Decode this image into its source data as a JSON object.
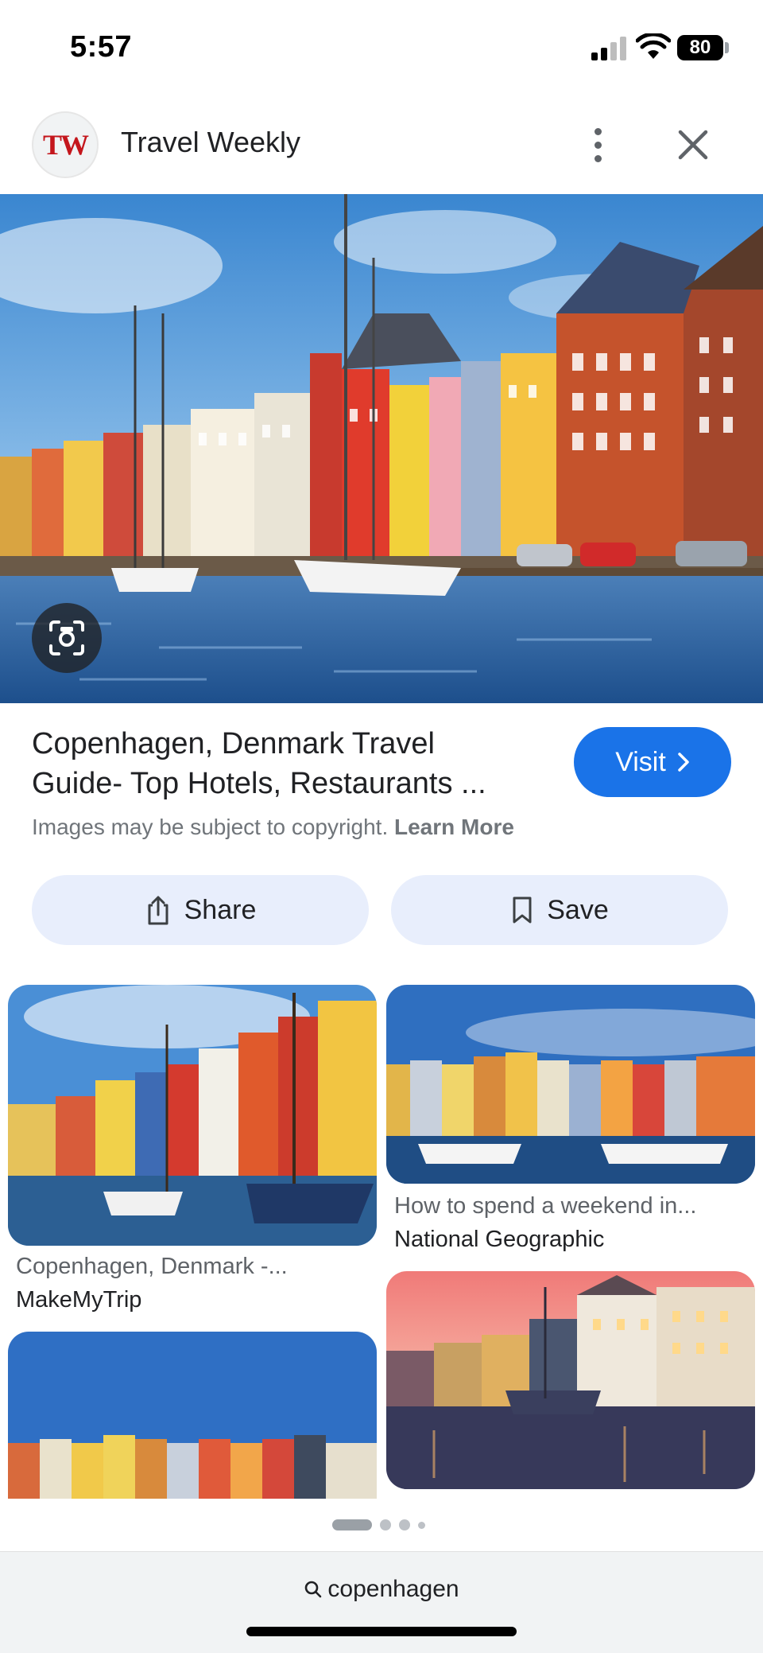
{
  "status": {
    "time": "5:57",
    "battery": "80"
  },
  "header": {
    "logo_text": "TW",
    "site_name": "Travel Weekly"
  },
  "result": {
    "title_line1": "Copenhagen, Denmark Travel",
    "title_line2": "Guide- Top Hotels, Restaurants ...",
    "visit_label": "Visit",
    "copyright_text": "Images may be subject to copyright.",
    "learn_more": "Learn More",
    "share_label": "Share",
    "save_label": "Save"
  },
  "related": [
    {
      "title": "Copenhagen, Denmark -...",
      "source": "MakeMyTrip"
    },
    {
      "title": "How to spend a weekend in...",
      "source": "National Geographic"
    }
  ],
  "bottom": {
    "query": "copenhagen"
  },
  "colors": {
    "accent": "#1a73e8",
    "pill_bg": "#e8eefc",
    "logo_red": "#c4161c"
  },
  "icons": [
    "close-icon",
    "more-vert-icon",
    "lens-icon",
    "share-icon",
    "bookmark-icon",
    "chevron-right-icon",
    "search-icon"
  ]
}
